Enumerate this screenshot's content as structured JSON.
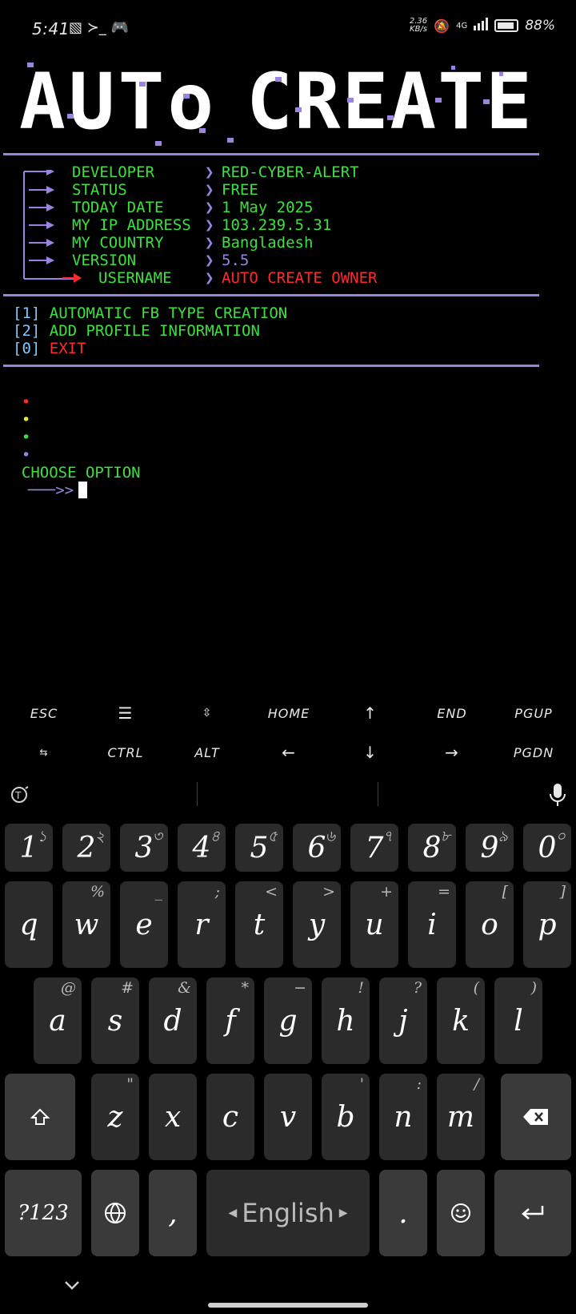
{
  "status_bar": {
    "time": "5:41",
    "left_icons": "▧ ≻_ 🎮",
    "net_speed_top": "2.36",
    "net_speed_bottom": "KB/s",
    "net_type": "4G",
    "battery_percent": "88%"
  },
  "banner": {
    "text_left": "AUTo",
    "text_right": "CREATE"
  },
  "info": {
    "rows": [
      {
        "label": "DEVELOPER",
        "value": "RED-CYBER-ALERT"
      },
      {
        "label": "STATUS",
        "value": "FREE"
      },
      {
        "label": "TODAY DATE",
        "value": "1 May 2025"
      },
      {
        "label": "MY IP ADDRESS",
        "value": "103.239.5.31"
      },
      {
        "label": "MY COUNTRY",
        "value": "Bangladesh"
      },
      {
        "label": "VERSION",
        "value": "5.5"
      },
      {
        "label": "USERNAME",
        "value": "AUTO CREATE OWNER"
      }
    ],
    "separator_glyph": "❯"
  },
  "menu": {
    "items": [
      {
        "key": "[1]",
        "label": "AUTOMATIC FB TYPE CREATION"
      },
      {
        "key": "[2]",
        "label": "ADD PROFILE INFORMATION"
      },
      {
        "key": "[0]",
        "label": "EXIT"
      }
    ]
  },
  "prompt": {
    "label": "CHOOSE OPTION",
    "arrow": "───>>"
  },
  "extra_keys": {
    "row1": [
      "ESC",
      "☰",
      "⇳",
      "HOME",
      "↑",
      "END",
      "PGUP"
    ],
    "row2": [
      "⇆",
      "CTRL",
      "ALT",
      "←",
      "↓",
      "→",
      "PGDN"
    ]
  },
  "keyboard": {
    "numbers": [
      "1",
      "2",
      "3",
      "4",
      "5",
      "6",
      "7",
      "8",
      "9",
      "0"
    ],
    "number_hints": [
      "১",
      "২",
      "৩",
      "৪",
      "৫",
      "৬",
      "৭",
      "৮",
      "৯",
      "০"
    ],
    "row_q": [
      "q",
      "w",
      "e",
      "r",
      "t",
      "y",
      "u",
      "i",
      "o",
      "p"
    ],
    "row_q_hints": [
      "",
      "%",
      "_",
      ";",
      "<",
      ">",
      "+",
      "=",
      "[",
      "]"
    ],
    "row_a": [
      "a",
      "s",
      "d",
      "f",
      "g",
      "h",
      "j",
      "k",
      "l"
    ],
    "row_a_hints": [
      "@",
      "#",
      "&",
      "*",
      "−",
      "!",
      "?",
      "(",
      ")"
    ],
    "row_z": [
      "z",
      "x",
      "c",
      "v",
      "b",
      "n",
      "m"
    ],
    "row_z_hints": [
      "\"",
      "",
      "",
      "",
      "'",
      ":",
      "/"
    ],
    "symbols_label": "?123",
    "comma_label": ",",
    "space_label": "English",
    "period_label": "."
  }
}
